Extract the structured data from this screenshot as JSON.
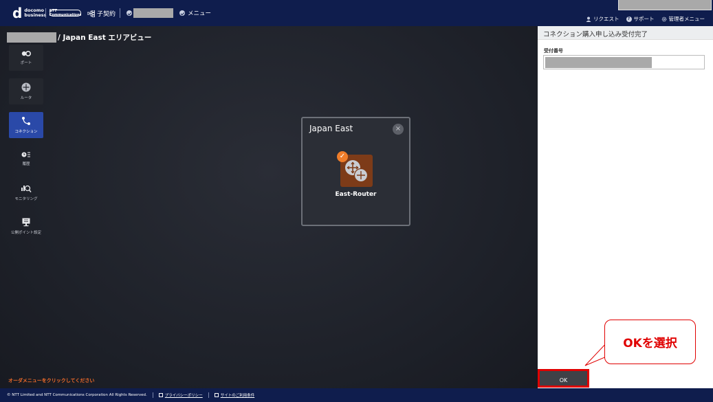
{
  "header": {
    "logo_mark": "d",
    "logo_line1": "docomo",
    "logo_line2": "business",
    "ntt_logo_text": "NTT Communications",
    "child_contract_label": "子契約",
    "menu_label": "メニュー",
    "right_links": [
      {
        "label": "リクエスト",
        "icon": "user-icon"
      },
      {
        "label": "サポート",
        "icon": "help-icon"
      },
      {
        "label": "管理者メニュー",
        "icon": "gear-icon"
      }
    ]
  },
  "breadcrumb": {
    "area_view_label": "/ Japan East エリアビュー"
  },
  "sidebar": {
    "items": [
      {
        "label": "ポート",
        "icon": "port-icon",
        "active": false
      },
      {
        "label": "ルータ",
        "icon": "router-icon",
        "active": false
      },
      {
        "label": "コネクション",
        "icon": "connection-icon",
        "active": true
      },
      {
        "label": "履歴",
        "icon": "history-icon",
        "active": false
      },
      {
        "label": "モニタリング",
        "icon": "monitoring-icon",
        "active": false
      },
      {
        "label": "公開ポイント設定",
        "icon": "public-point-icon",
        "active": false
      }
    ]
  },
  "popup": {
    "title": "Japan East",
    "close_symbol": "×",
    "router_name": "East-Router",
    "check_symbol": "✓"
  },
  "order_hint": "オーダメニューをクリックしてください",
  "right_panel": {
    "title": "コネクション購入申し込み受付完了",
    "field_label": "受付番号",
    "ok_label": "OK"
  },
  "callout": {
    "text": "OKを選択"
  },
  "footer": {
    "copyright": "© NTT Limited and NTT Communications Corporation All Rights Reserved.",
    "privacy_link": "プライバシーポリシー",
    "terms_link": "サイトのご利用条件"
  },
  "colors": {
    "header_bg": "#0f1d4d",
    "accent_orange": "#ef7d2a",
    "active_blue": "#2a49a8",
    "highlight_red": "#e00000"
  }
}
